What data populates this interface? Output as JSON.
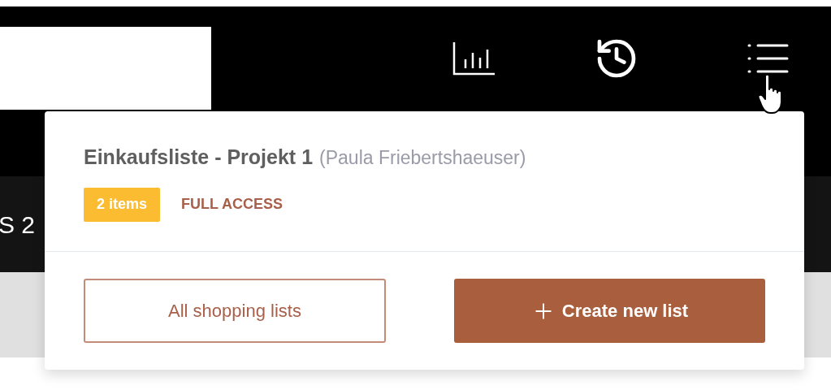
{
  "background_text": "S 2",
  "popup": {
    "title": "Einkaufsliste - Projekt 1",
    "owner": "(Paula Friebertshaeuser)",
    "badge": "2 items",
    "access": "FULL ACCESS",
    "buttons": [
      {
        "kind": "outline",
        "label": "All shopping lists"
      },
      {
        "kind": "primary",
        "label": "Create new list"
      }
    ]
  }
}
